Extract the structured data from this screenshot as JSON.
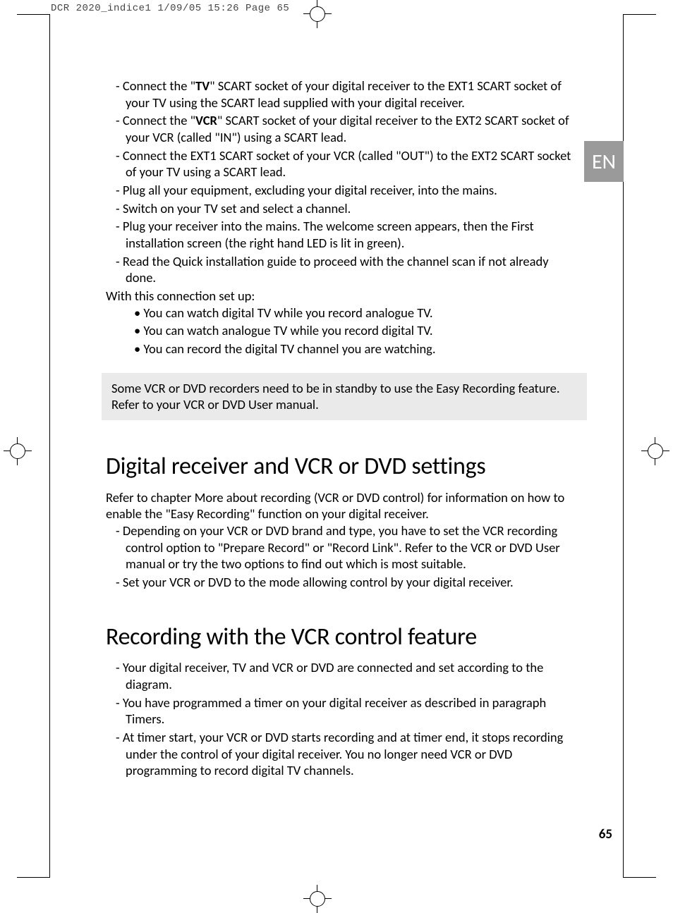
{
  "slug": "DCR 2020_indice1  1/09/05  15:26  Page 65",
  "lang_tab": "EN",
  "page_number": "65",
  "section_top": {
    "dash_items": [
      {
        "pre": "Connect the \"",
        "bold": "TV",
        "post": "\" SCART socket of your digital receiver to the EXT1 SCART socket of your TV using the SCART lead supplied with your digital receiver."
      },
      {
        "pre": "Connect the \"",
        "bold": "VCR",
        "post": "\" SCART socket of your digital receiver to the EXT2 SCART socket of your VCR (called \"IN\") using a SCART lead."
      },
      {
        "plain": "Connect the EXT1 SCART socket of your VCR (called \"OUT\") to the EXT2 SCART socket of your TV using a SCART lead."
      },
      {
        "plain": "Plug all your equipment, excluding your digital receiver, into the mains."
      },
      {
        "plain": "Switch on your TV set and select a channel."
      },
      {
        "plain": "Plug your receiver into the mains. The welcome screen appears, then the First installation screen (the right hand LED is lit in green)."
      },
      {
        "plain": "Read the Quick installation guide to proceed with the channel scan if not already done."
      }
    ],
    "lead_para": "With this connection set up:",
    "bullets": [
      "You can watch digital TV while you record analogue TV.",
      "You can watch analogue TV while you record digital TV.",
      "You can record the digital TV channel you are watching."
    ],
    "note": "Some VCR or DVD recorders need to be in standby to use the Easy Recording feature. Refer to your VCR or DVD User manual."
  },
  "section_settings": {
    "heading": "Digital receiver and VCR or DVD settings",
    "intro": "Refer to chapter More about recording (VCR or DVD control) for information on how to enable the \"Easy Recording\" function on your digital receiver.",
    "dash_items": [
      "Depending on your VCR or DVD brand and type, you have to set the VCR recording control option to \"Prepare Record\" or \"Record Link\". Refer to the VCR or DVD User manual or try the two options to find out which is most suitable.",
      "Set your VCR or DVD to the mode allowing control by your digital receiver."
    ]
  },
  "section_recording": {
    "heading": "Recording with the VCR control feature",
    "dash_items": [
      "Your digital receiver, TV and VCR or DVD are connected and set according to the diagram.",
      "You have programmed a timer on your digital receiver as described in paragraph Timers.",
      "At timer start, your VCR or DVD starts recording and at timer end, it stops recording under the control of your digital receiver. You no longer need VCR or DVD programming to record digital TV channels."
    ]
  }
}
